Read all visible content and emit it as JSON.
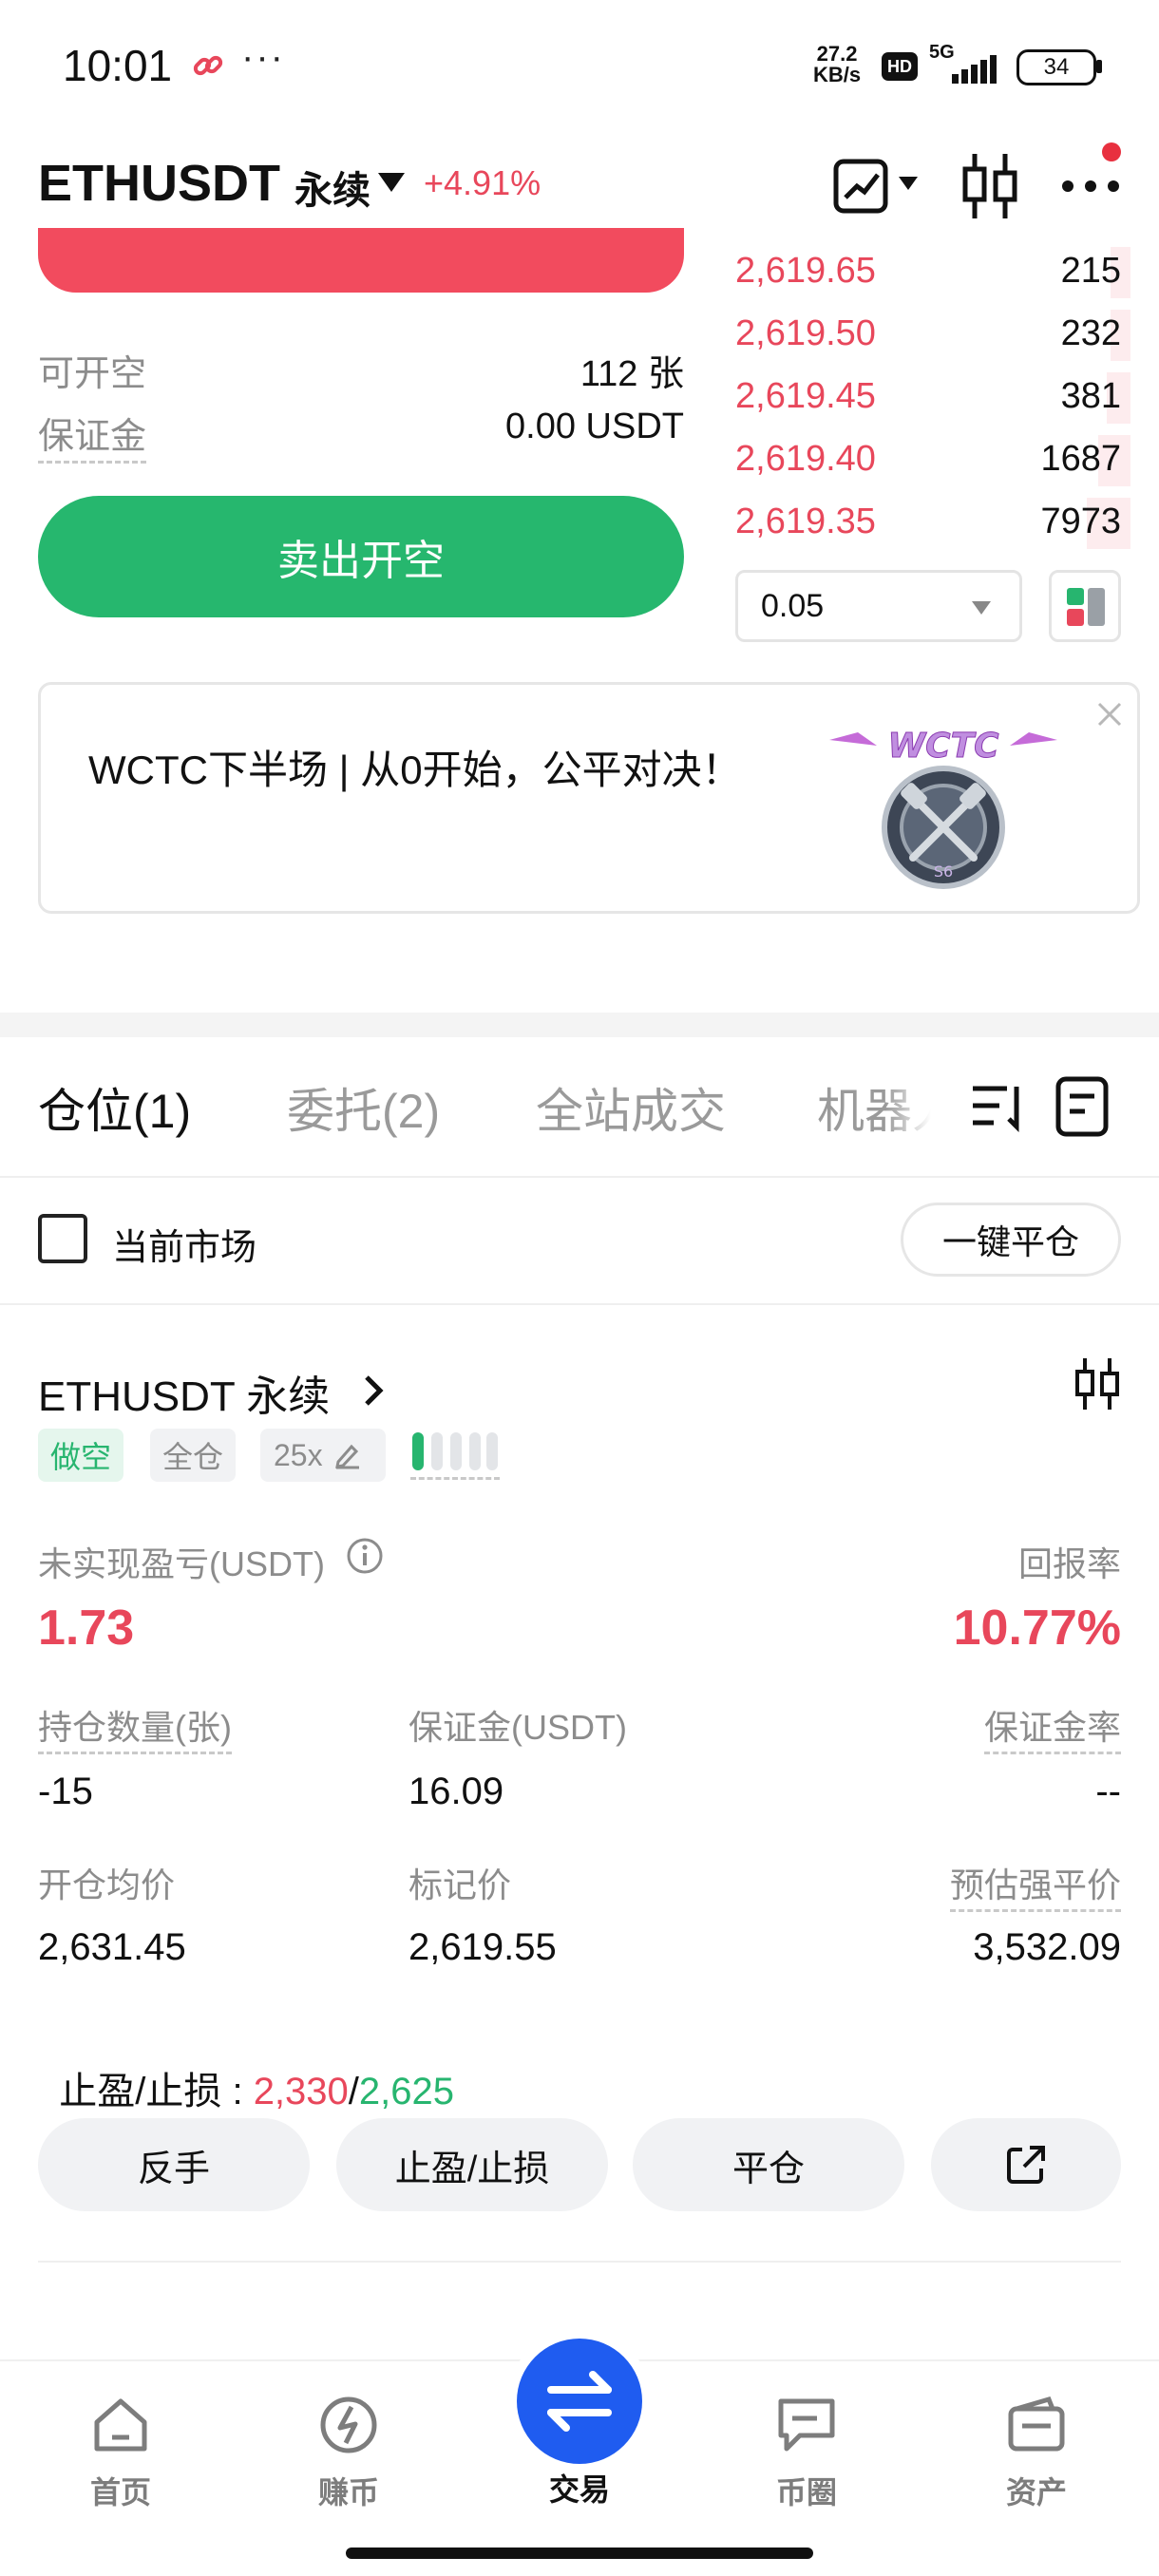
{
  "status_bar": {
    "time": "10:01",
    "more": "···",
    "net_speed_top": "27.2",
    "net_speed_bottom": "KB/s",
    "hd": "HD",
    "network": "5G",
    "battery": "34"
  },
  "header": {
    "symbol": "ETHUSDT",
    "contract_type": "永续",
    "change_pct": "+4.91%"
  },
  "order_form": {
    "available_short_label": "可开空",
    "available_short_value": "112 张",
    "margin_label": "保证金",
    "margin_value": "0.00 USDT",
    "sell_button": "卖出开空"
  },
  "order_book": {
    "asks": [
      {
        "price": "2,619.65",
        "qty": "215",
        "depth": 0.05
      },
      {
        "price": "2,619.50",
        "qty": "232",
        "depth": 0.05
      },
      {
        "price": "2,619.45",
        "qty": "381",
        "depth": 0.06
      },
      {
        "price": "2,619.40",
        "qty": "1687",
        "depth": 0.08
      },
      {
        "price": "2,619.35",
        "qty": "7973",
        "depth": 0.11
      }
    ],
    "precision": "0.05"
  },
  "banner": {
    "text": "WCTC下半场 | 从0开始，公平对决！",
    "logo_text": "WCTC",
    "badge_text": "S6"
  },
  "tabs": [
    {
      "label": "仓位(1)",
      "active": true
    },
    {
      "label": "委托(2)",
      "active": false
    },
    {
      "label": "全站成交",
      "active": false
    },
    {
      "label": "机器人",
      "active": false
    }
  ],
  "filter": {
    "current_market": "当前市场",
    "close_all": "一键平仓"
  },
  "position": {
    "title": "ETHUSDT 永续",
    "side": "做空",
    "margin_mode": "全仓",
    "leverage": "25x",
    "unrealized_pnl_label": "未实现盈亏(USDT)",
    "unrealized_pnl": "1.73",
    "roe_label": "回报率",
    "roe": "10.77%",
    "size_label": "持仓数量(张)",
    "size": "-15",
    "margin_label": "保证金(USDT)",
    "margin": "16.09",
    "margin_ratio_label": "保证金率",
    "margin_ratio": "--",
    "entry_label": "开仓均价",
    "entry": "2,631.45",
    "mark_label": "标记价",
    "mark": "2,619.55",
    "liq_label": "预估强平价",
    "liq": "3,532.09",
    "tpsl_label": "止盈/止损 : ",
    "tp": "2,330",
    "sep": "/",
    "sl": "2,625",
    "actions": {
      "reverse": "反手",
      "tpsl": "止盈/止损",
      "close": "平仓"
    }
  },
  "bottom_nav": [
    {
      "label": "首页",
      "icon": "home-icon"
    },
    {
      "label": "赚币",
      "icon": "earn-icon"
    },
    {
      "label": "交易",
      "icon": "trade-icon"
    },
    {
      "label": "币圈",
      "icon": "chat-icon"
    },
    {
      "label": "资产",
      "icon": "wallet-icon"
    }
  ],
  "colors": {
    "red": "#e8475b",
    "green": "#27b56f",
    "nav_blue": "#1f5cf0"
  }
}
